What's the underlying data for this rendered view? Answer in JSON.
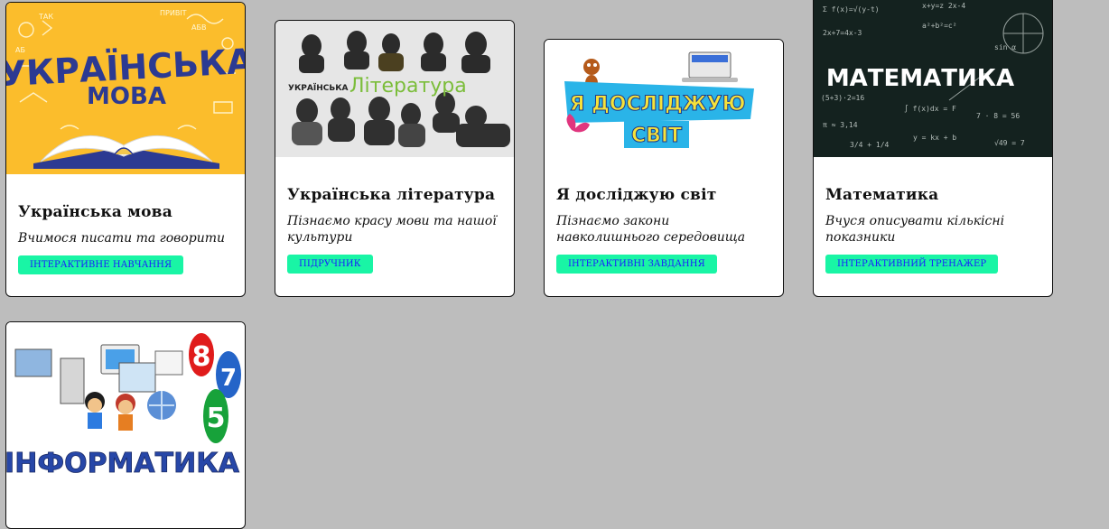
{
  "cards": [
    {
      "title": "Українська мова",
      "subtitle": "Вчимося писати та говорити",
      "button": "ІНТЕРАКТИВНЕ НАВЧАННЯ",
      "image_text": [
        "УКРАЇНСЬКА",
        "МОВА"
      ],
      "image_bg": "#fbbd2c"
    },
    {
      "title": "Українська література",
      "subtitle": "Пізнаємо красу мови та нашої культури",
      "button": "ПІДРУЧНИК",
      "image_text": [
        "УКРАЇНСЬКА",
        "Література"
      ],
      "image_bg": "#e6e6e6"
    },
    {
      "title": "Я досліджую світ",
      "subtitle": "Пізнаємо закони навколишнього середовища",
      "button": "ІНТЕРАКТИВНІ ЗАВДАННЯ",
      "image_text": [
        "Я ДОСЛІДЖУЮ",
        "СВІТ"
      ],
      "image_bg": "#ffffff"
    },
    {
      "title": "Математика",
      "subtitle": "Вчуся описувати кількісні показники",
      "button": "ІНТЕРАКТИВНИЙ ТРЕНАЖЕР",
      "image_text": [
        "МАТЕМАТИКА"
      ],
      "image_bg": "#14221f"
    },
    {
      "title": "",
      "subtitle": "",
      "button": "",
      "image_text": [
        "ІНФОРМАТИКА",
        "8",
        "7",
        "5"
      ],
      "image_bg": "#ffffff"
    }
  ],
  "colors": {
    "page_bg": "#bdbdbd",
    "button_bg": "#19f5a5",
    "button_text": "#1a1aff"
  }
}
